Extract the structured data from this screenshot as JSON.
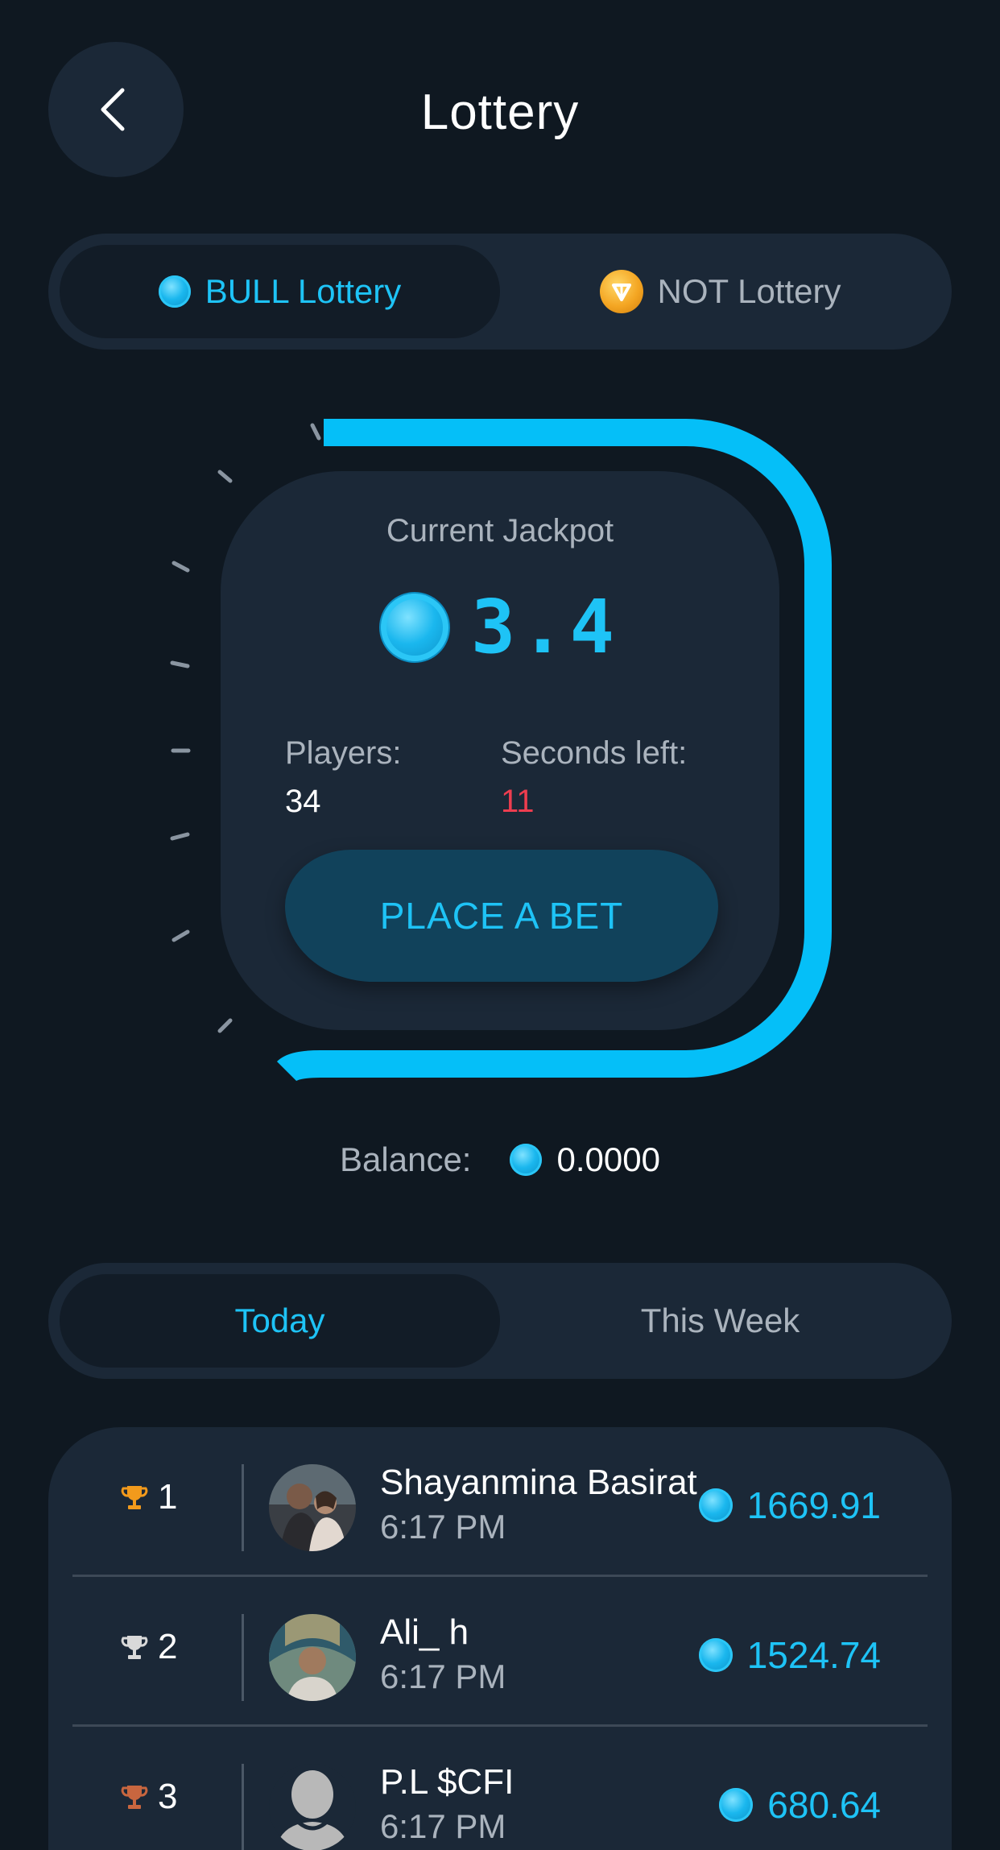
{
  "header": {
    "title": "Lottery",
    "back_icon": "chevron-left-icon"
  },
  "lottery_tabs": [
    {
      "label": "BULL Lottery",
      "icon": "bull-coin-icon",
      "active": true
    },
    {
      "label": "NOT Lottery",
      "icon": "not-coin-icon",
      "active": false
    }
  ],
  "jackpot": {
    "label": "Current Jackpot",
    "value": "3.4",
    "players_label": "Players:",
    "players_value": "34",
    "seconds_label": "Seconds left:",
    "seconds_value": "11",
    "bet_button": "PLACE A BET"
  },
  "balance": {
    "label": "Balance:",
    "value": "0.0000"
  },
  "period_tabs": [
    {
      "label": "Today",
      "active": true
    },
    {
      "label": "This Week",
      "active": false
    }
  ],
  "leaderboard": [
    {
      "rank": "1",
      "trophy": "gold-trophy-icon",
      "name": "Shayanmina Basirat",
      "time": "6:17 PM",
      "amount": "1669.91"
    },
    {
      "rank": "2",
      "trophy": "silver-trophy-icon",
      "name": "Ali_ h",
      "time": "6:17 PM",
      "amount": "1524.74"
    },
    {
      "rank": "3",
      "trophy": "bronze-trophy-icon",
      "name": "P.L $CFI",
      "time": "6:17 PM",
      "amount": "680.64"
    }
  ],
  "colors": {
    "background": "#0f1821",
    "surface": "#1b2837",
    "accent": "#1ec3f6",
    "countdown": "#ee3d4f",
    "gold": "#f29a1c",
    "silver": "#d9d9d9",
    "bronze": "#c8663f"
  }
}
